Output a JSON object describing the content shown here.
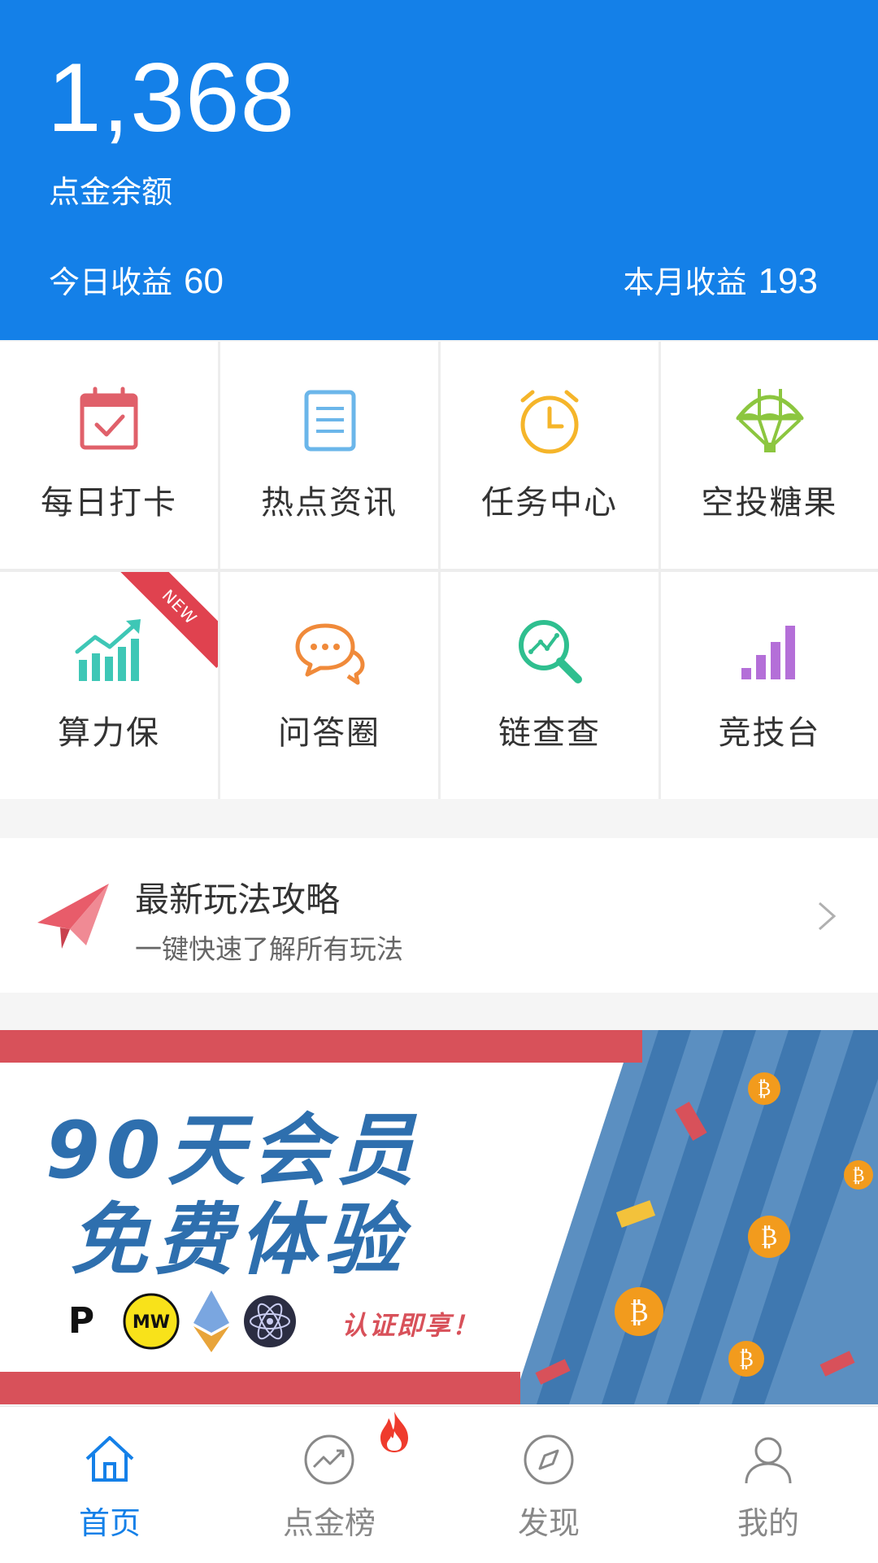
{
  "header": {
    "balance": "1,368",
    "balance_label": "点金余额",
    "today_label": "今日收益",
    "today_value": "60",
    "month_label": "本月收益",
    "month_value": "193",
    "bg_color": "#1480e8"
  },
  "grid": {
    "items": [
      {
        "label": "每日打卡",
        "icon": "calendar-check-icon"
      },
      {
        "label": "热点资讯",
        "icon": "document-icon"
      },
      {
        "label": "任务中心",
        "icon": "alarm-clock-icon"
      },
      {
        "label": "空投糖果",
        "icon": "parachute-icon"
      },
      {
        "label": "算力保",
        "icon": "trend-chart-icon",
        "badge": "NEW"
      },
      {
        "label": "问答圈",
        "icon": "chat-bubbles-icon"
      },
      {
        "label": "链查查",
        "icon": "search-chart-icon"
      },
      {
        "label": "竞技台",
        "icon": "bar-chart-icon"
      }
    ]
  },
  "guide": {
    "title": "最新玩法攻略",
    "subtitle": "一键快速了解所有玩法"
  },
  "promo": {
    "line1": "90天会员",
    "line2": "免费体验",
    "cta": "认证即享！"
  },
  "nav": {
    "tabs": [
      {
        "label": "首页",
        "icon": "home-icon",
        "active": true
      },
      {
        "label": "点金榜",
        "icon": "trending-icon",
        "active": false
      },
      {
        "label": "发现",
        "icon": "compass-icon",
        "active": false
      },
      {
        "label": "我的",
        "icon": "user-icon",
        "active": false
      }
    ]
  }
}
